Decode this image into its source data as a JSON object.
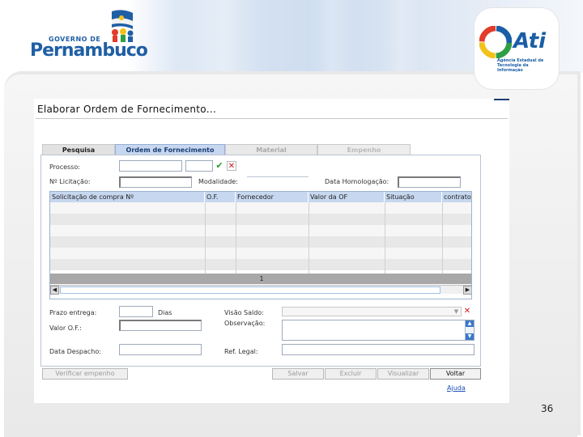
{
  "header": {
    "gov_logo": {
      "line1": "GOVERNO DE",
      "line2": "Pernambuco"
    },
    "ati_logo": {
      "name": "Ati",
      "subtitle": "Agência Estadual de Tecnologia da Informação"
    }
  },
  "screen": {
    "title": "Elaborar Ordem de Fornecimento...",
    "tabs": [
      {
        "label": "Pesquisa",
        "state": "normal"
      },
      {
        "label": "Ordem de Fornecimento",
        "state": "active"
      },
      {
        "label": "Material",
        "state": "disabled"
      },
      {
        "label": "Empenho",
        "state": "disabled"
      }
    ],
    "fields": {
      "processo": {
        "label": "Processo:",
        "value": "",
        "value2": ""
      },
      "licitacao": {
        "label": "Nº Licitação:",
        "value": ""
      },
      "modalidade": {
        "label": "Modalidade:",
        "value": ""
      },
      "homologacao": {
        "label": "Data Homologação:",
        "value": ""
      },
      "prazo": {
        "label": "Prazo entrega:",
        "value": "",
        "unit": "Dias"
      },
      "valor_of": {
        "label": "Valor O.F.:",
        "value": ""
      },
      "data_despacho": {
        "label": "Data Despacho:",
        "value": ""
      },
      "visao_saldo": {
        "label": "Visão Saldo:",
        "value": ""
      },
      "observacao": {
        "label": "Observação:",
        "value": ""
      },
      "ref_legal": {
        "label": "Ref. Legal:",
        "value": ""
      }
    },
    "grid": {
      "columns": [
        "Solicitação de compra Nº",
        "O.F.",
        "Fornecedor",
        "Valor da OF",
        "Situação",
        "contrato"
      ],
      "rows": [],
      "page_label": "1"
    },
    "buttons": {
      "verificar_empenho": "Verificar empenho",
      "salvar": "Salvar",
      "excluir": "Excluir",
      "visualizar": "Visualizar",
      "voltar": "Voltar"
    },
    "help_link": "Ajuda"
  },
  "slide_number": "36",
  "colors": {
    "accent_blue": "#1c3e73",
    "tab_active": "#c7d7ef",
    "grid_header": "#c6d7ef",
    "confirm_green": "#2a9d35",
    "cancel_red": "#cc1b1b",
    "link_blue": "#1d4fb5"
  },
  "icons": [
    "confirm-check-icon",
    "clear-x-icon",
    "scroll-left-icon",
    "scroll-right-icon",
    "scroll-up-icon",
    "scroll-down-icon",
    "dropdown-arrow-icon"
  ]
}
